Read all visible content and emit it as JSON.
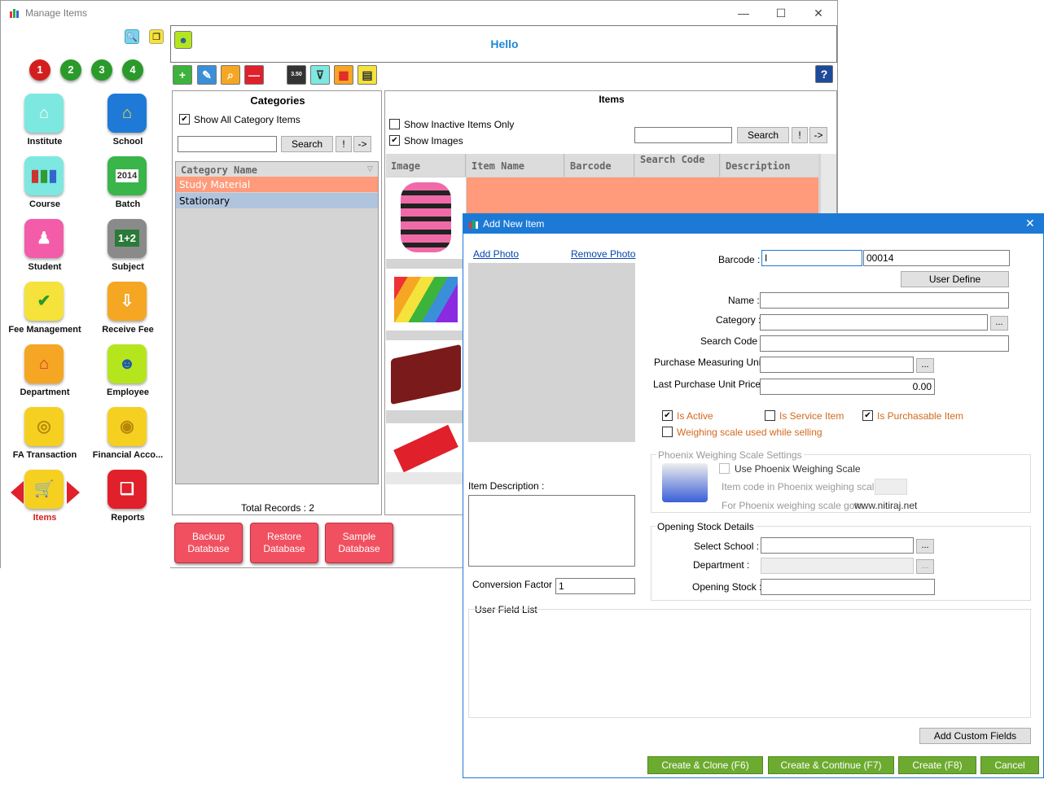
{
  "window": {
    "title": "Manage Items"
  },
  "header": {
    "greeting": "Hello"
  },
  "sidebar": {
    "numbers": [
      "1",
      "2",
      "3",
      "4"
    ],
    "items": [
      {
        "label": "Institute",
        "icon": "house-icon"
      },
      {
        "label": "School",
        "icon": "school-icon"
      },
      {
        "label": "Course",
        "icon": "books-icon"
      },
      {
        "label": "Batch",
        "icon": "calendar-icon"
      },
      {
        "label": "Student",
        "icon": "student-icon"
      },
      {
        "label": "Subject",
        "icon": "chalkboard-icon"
      },
      {
        "label": "Fee Management",
        "icon": "fee-list-icon"
      },
      {
        "label": "Receive Fee",
        "icon": "receive-fee-icon"
      },
      {
        "label": "Department",
        "icon": "department-icon"
      },
      {
        "label": "Employee",
        "icon": "employee-icon"
      },
      {
        "label": "FA Transaction",
        "icon": "coins-icon"
      },
      {
        "label": "Financial Acco...",
        "icon": "coins-stack-icon"
      },
      {
        "label": "Items",
        "icon": "cart-icon"
      },
      {
        "label": "Reports",
        "icon": "scroll-icon"
      }
    ]
  },
  "toolbar": {
    "calc_text": "3.50"
  },
  "categories": {
    "title": "Categories",
    "show_all_label": "Show All Category Items",
    "search_label": "Search",
    "bang_label": "!",
    "arrow_label": "->",
    "column": "Category Name",
    "rows": [
      "Study Material",
      "Stationary"
    ],
    "total": "Total Records : 2"
  },
  "items": {
    "title": "Items",
    "inactive_label": "Show Inactive Items Only",
    "images_label": "Show Images",
    "search_label": "Search",
    "bang_label": "!",
    "arrow_label": "->",
    "columns": [
      "Image",
      "Item Name",
      "Barcode",
      "Search Code",
      "Description"
    ]
  },
  "db_buttons": [
    "Backup Database",
    "Restore Database",
    "Sample Database"
  ],
  "dialog": {
    "title": "Add New Item",
    "add_photo": "Add Photo",
    "remove_photo": "Remove Photo",
    "barcode_label": "Barcode :",
    "barcode_prefix": "I",
    "barcode_value": "00014",
    "user_define": "User Define",
    "name_label": "Name :",
    "category_label": "Category :",
    "search_code_label": "Search Code :",
    "pmu_label": "Purchase Measuring Unit :",
    "lpu_label": "Last Purchase  Unit Price :",
    "lpu_value": "0.00",
    "ellipsis": "...",
    "is_active": "Is Active",
    "is_service": "Is Service Item",
    "is_purchasable": "Is Purchasable Item",
    "weighing": "Weighing scale used while selling",
    "phoenix_group": "Phoenix Weighing Scale Settings",
    "use_phoenix": "Use Phoenix Weighing Scale",
    "item_code_phoenix": "Item code in Phoenix weighing scale :",
    "phoenix_goto": "For Phoenix weighing scale goto:",
    "phoenix_url": "www.nitiraj.net",
    "item_desc_label": "Item Description :",
    "conversion_label": "Conversion Factor :",
    "conversion_value": "1",
    "opening_group": "Opening Stock Details",
    "select_school": "Select School :",
    "department": "Department :",
    "opening_stock": "Opening Stock :",
    "user_field_list": "User Field List",
    "add_custom": "Add Custom Fields",
    "create_clone": "Create & Clone (F6)",
    "create_continue": "Create & Continue (F7)",
    "create": "Create (F8)",
    "cancel": "Cancel"
  },
  "colors": {
    "accent": "#1c7ad6",
    "selected_row": "#ff9a7a",
    "alt_row": "#b0c4de",
    "db_button": "#f05060",
    "green_button": "#6cab30"
  }
}
